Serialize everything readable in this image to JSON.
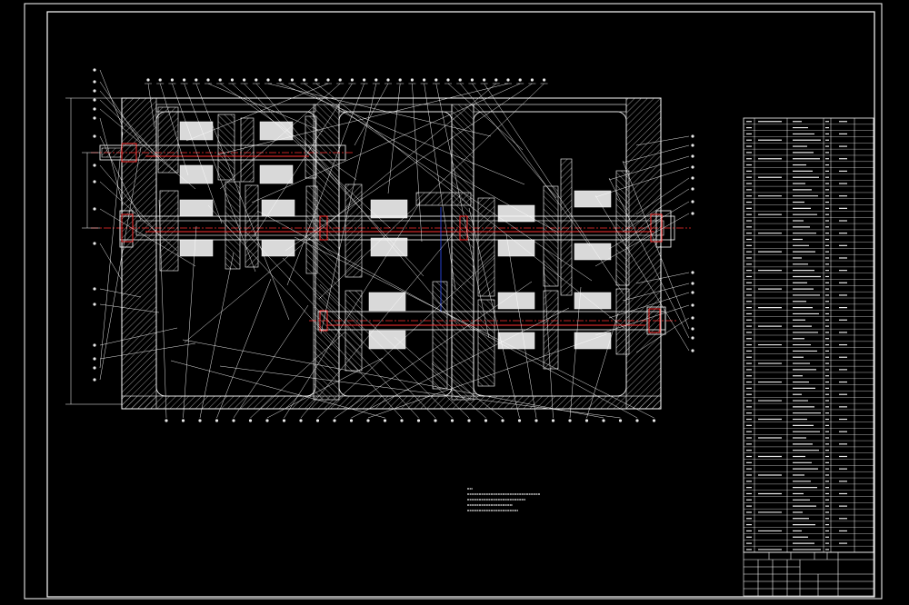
{
  "colors": {
    "background": "#000000",
    "outline": "#ffffff",
    "centerline": "#ff3030",
    "dimension": "#3050ff",
    "hatch": "#d0d0d0",
    "text": "#e8e8e8"
  },
  "drawing": {
    "type": "gearbox-assembly-section",
    "frame": true,
    "title_block": true,
    "bill_of_materials": true,
    "technical_notes": true
  }
}
